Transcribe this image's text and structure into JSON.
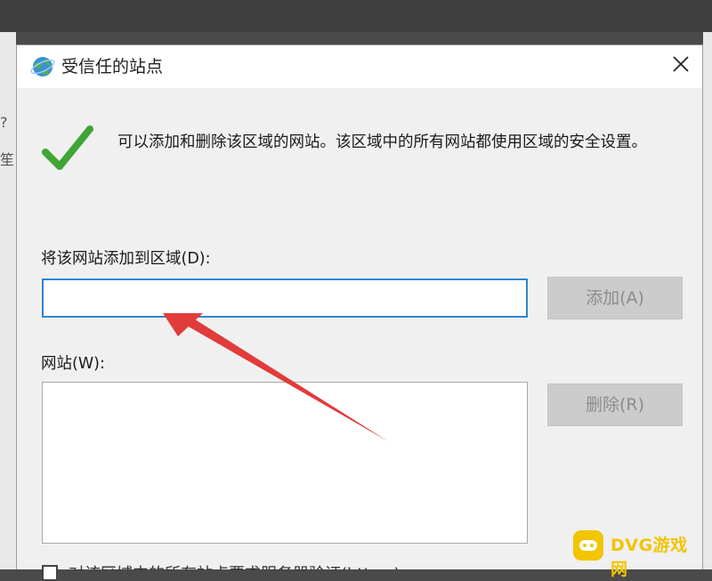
{
  "dialog": {
    "title": "受信任的站点",
    "description": "可以添加和删除该区域的网站。该区域中的所有网站都使用区域的安全设置。",
    "add_label": "将该网站添加到区域(D):",
    "site_input": {
      "value": "",
      "placeholder": ""
    },
    "add_button": "添加(A)",
    "sites_label": "网站(W):",
    "sites": [],
    "remove_button": "删除(R)",
    "https_checkbox_label": "对该区域中的所有站点要求服务器验证(https:)"
  },
  "background": {
    "left_fragment_1": "?",
    "left_fragment_2": "笙"
  },
  "watermark": {
    "text": "DVG游戏网"
  },
  "colors": {
    "input_border": "#2f86d1",
    "check": "#3fa535",
    "arrow": "#e23b3b",
    "watermark": "#f2c500"
  },
  "icons": [
    "globe-icon",
    "close-icon",
    "checkmark-icon",
    "arrow-annotation"
  ]
}
